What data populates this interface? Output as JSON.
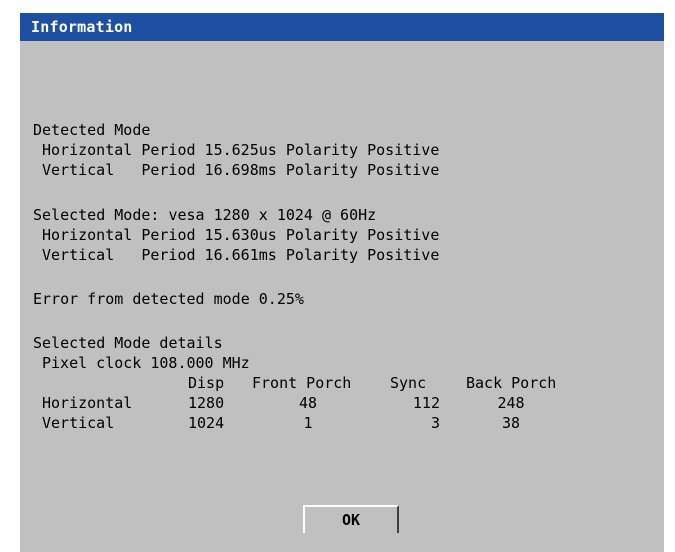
{
  "window": {
    "title": "Information",
    "title_bar_color": "#1d4fa3",
    "background_color": "#c0c0c0"
  },
  "detected": {
    "heading": "Detected Mode",
    "horizontal": "Horizontal Period 15.625us Polarity Positive",
    "vertical": "Vertical   Period 16.698ms Polarity Positive"
  },
  "selected": {
    "heading": "Selected Mode: vesa 1280 x 1024 @ 60Hz",
    "horizontal": "Horizontal Period 15.630us Polarity Positive",
    "vertical": "Vertical   Period 16.661ms Polarity Positive"
  },
  "error_text": "Error from detected mode 0.25%",
  "details": {
    "heading": "Selected Mode details",
    "pixel_clock": "Pixel clock 108.000 MHz",
    "headers": {
      "disp": "Disp",
      "front_porch": "Front Porch",
      "sync": "Sync",
      "back_porch": "Back Porch"
    },
    "rows": [
      {
        "label": "Horizontal",
        "disp": "1280",
        "front_porch": "48",
        "sync": "112",
        "back_porch": "248"
      },
      {
        "label": "Vertical",
        "disp": "1024",
        "front_porch": "1",
        "sync": "3",
        "back_porch": "38"
      }
    ]
  },
  "buttons": {
    "ok_label": "OK"
  }
}
